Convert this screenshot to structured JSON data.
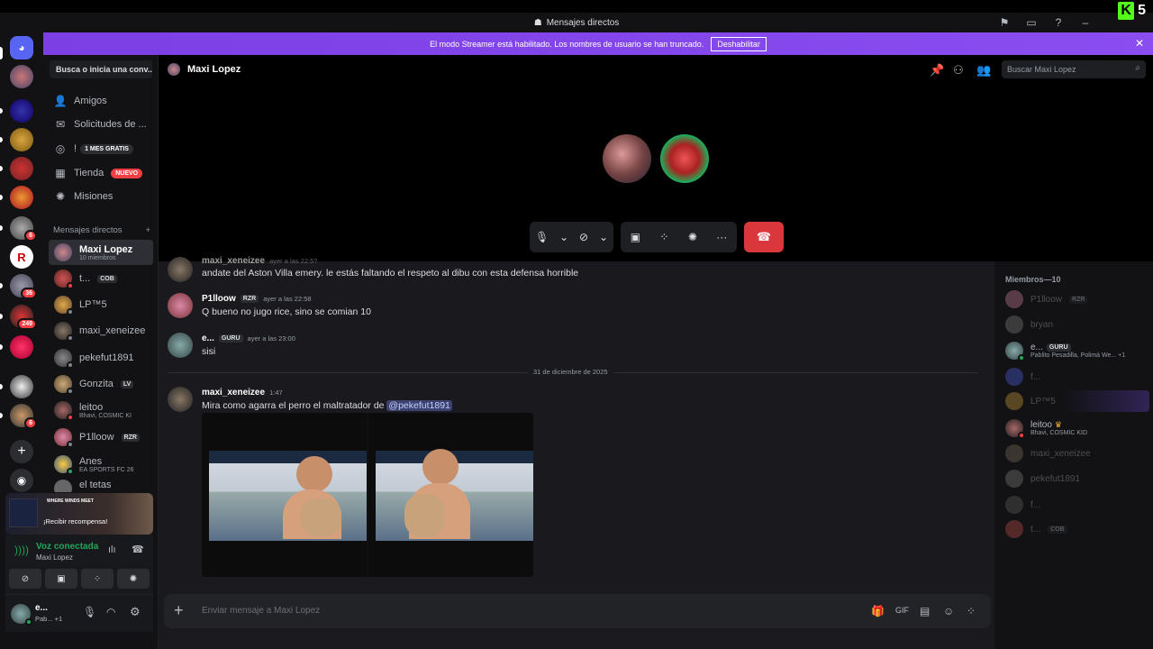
{
  "window": {
    "title": "Mensajes directos"
  },
  "kick": {
    "count": "5"
  },
  "banner": {
    "text": "El modo Streamer está habilitado. Los nombres de usuario se han truncado.",
    "button": "Deshabilitar"
  },
  "rail": {
    "badges": [
      "6",
      "36",
      "249",
      "6"
    ]
  },
  "sidebar": {
    "search_placeholder": "Busca o inicia una conv...",
    "nav": [
      {
        "label": "Amigos",
        "icon": "friends-icon"
      },
      {
        "label": "Solicitudes de ...",
        "icon": "mail-icon"
      },
      {
        "label": "!",
        "icon": "nitro-icon",
        "tag": "1 MES GRATIS"
      },
      {
        "label": "Tienda",
        "icon": "shop-icon",
        "tag": "NUEVO"
      },
      {
        "label": "Misiones",
        "icon": "quests-icon"
      }
    ],
    "dm_header": "Mensajes directos",
    "dms": [
      {
        "name": "Maxi Lopez",
        "sub": "10 miembros"
      },
      {
        "name": "t...",
        "tag": "COB"
      },
      {
        "name": "LP™5"
      },
      {
        "name": "maxi_xeneizee"
      },
      {
        "name": "pekefut1891"
      },
      {
        "name": "Gonzita",
        "tag": "LV"
      },
      {
        "name": "leitoo",
        "sub": "Bhavi, COSMIC KI"
      },
      {
        "name": "P1lloow",
        "tag": "RZR"
      },
      {
        "name": "Anes",
        "sub": "EA SPORTS FC 26"
      },
      {
        "name": "el tetas"
      }
    ],
    "promo": {
      "logo": "WHERE WINDS MEET",
      "text": "¡Recibir recompensa!"
    },
    "voice": {
      "status": "Voz conectada",
      "channel": "Maxi Lopez"
    },
    "user": {
      "name": "e...",
      "sub": "Pab... +1"
    }
  },
  "header": {
    "name": "Maxi Lopez",
    "search_placeholder": "Buscar Maxi Lopez"
  },
  "messages": [
    {
      "author": "maxi_xeneizee",
      "time": "ayer a las 22:5?",
      "text": "andate del Aston Villa emery. le estás faltando el respeto al dibu con esta defensa horrible"
    },
    {
      "author": "P1lloow",
      "tag": "RZR",
      "time": "ayer a las 22:58",
      "text": "Q bueno no jugo rice, sino se comian 10"
    },
    {
      "author": "e...",
      "tag": "GURU",
      "time": "ayer a las 23:00",
      "text": "sisi"
    },
    {
      "author": "maxi_xeneizee",
      "time": "1:47",
      "text": "Mira como agarra el perro el maltratador de ",
      "mention": "@pekefut1891"
    }
  ],
  "date_divider": "31 de diciembre de 2025",
  "composer": {
    "placeholder": "Enviar mensaje a Maxi Lopez"
  },
  "members": {
    "header": "Miembros—10",
    "list": [
      {
        "name": "P1lloow",
        "tag": "RZR",
        "dim": true
      },
      {
        "name": "bryan",
        "dim": true
      },
      {
        "name": "e...",
        "tag": "GURU",
        "sub": "Pablito Pesadilla, Polimá We... +1",
        "dim": false
      },
      {
        "name": "f...",
        "dim": true
      },
      {
        "name": "LP™5",
        "dim": true
      },
      {
        "name": "leitoo",
        "sub": "Bhavi, COSMIC KID",
        "dim": false
      },
      {
        "name": "maxi_xeneizee",
        "dim": true
      },
      {
        "name": "pekefut1891",
        "dim": true
      },
      {
        "name": "f...",
        "dim": true
      },
      {
        "name": "t...",
        "tag": "COB",
        "dim": true
      }
    ]
  }
}
